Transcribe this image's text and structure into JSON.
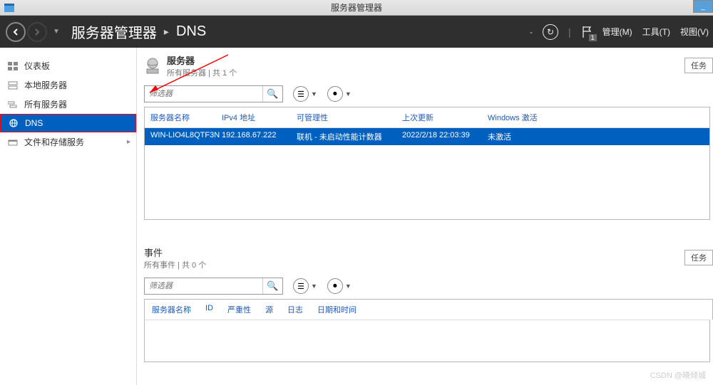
{
  "window": {
    "title": "服务器管理器",
    "minimize": "_"
  },
  "header": {
    "breadcrumb_root": "服务器管理器",
    "breadcrumb_current": "DNS",
    "menu_manage": "管理(M)",
    "menu_tools": "工具(T)",
    "menu_view": "视图(V)",
    "notification_count": "1"
  },
  "sidebar": {
    "items": [
      {
        "label": "仪表板"
      },
      {
        "label": "本地服务器"
      },
      {
        "label": "所有服务器"
      },
      {
        "label": "DNS"
      },
      {
        "label": "文件和存储服务"
      }
    ]
  },
  "servers_section": {
    "title": "服务器",
    "subtitle": "所有服务器 | 共 1 个",
    "tasks_label": "任务",
    "filter_placeholder": "筛选器",
    "columns": {
      "name": "服务器名称",
      "ip": "IPv4 地址",
      "manageability": "可管理性",
      "last_update": "上次更新",
      "activation": "Windows 激活"
    },
    "rows": [
      {
        "name": "WIN-LIO4L8QTF3N",
        "ip": "192.168.67.222",
        "manageability": "联机 - 未启动性能计数器",
        "last_update": "2022/2/18 22:03:39",
        "activation": "未激活"
      }
    ]
  },
  "events_section": {
    "title": "事件",
    "subtitle": "所有事件 | 共 0 个",
    "tasks_label": "任务",
    "filter_placeholder": "筛选器",
    "columns": {
      "name": "服务器名称",
      "id": "ID",
      "severity": "严重性",
      "source": "源",
      "log": "日志",
      "datetime": "日期和时间"
    }
  },
  "watermark": "CSDN @晓倾城"
}
